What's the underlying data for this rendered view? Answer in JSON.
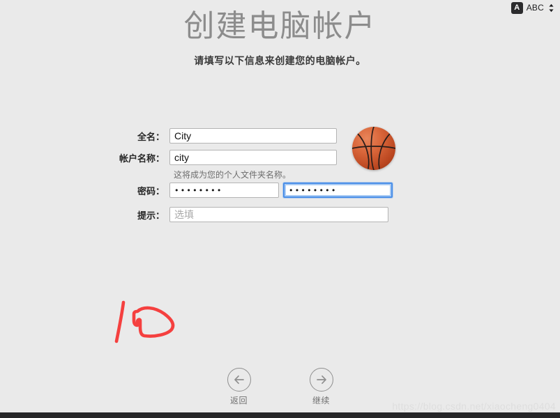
{
  "menubar": {
    "flag_label": "A",
    "input_source": "ABC",
    "chevron_icon": "chevron-up-down-icon"
  },
  "header": {
    "title": "创建电脑帐户",
    "subtitle": "请填写以下信息来创建您的电脑帐户。"
  },
  "form": {
    "fullname": {
      "label": "全名：",
      "value": "City"
    },
    "account": {
      "label": "帐户名称：",
      "value": "city",
      "helper": "这将成为您的个人文件夹名称。"
    },
    "password": {
      "label": "密码：",
      "value": "••••••••",
      "verify_value": "••••••••",
      "focused_field": "verify"
    },
    "hint": {
      "label": "提示：",
      "value": "",
      "placeholder": "选填"
    }
  },
  "avatar": {
    "name": "basketball-avatar",
    "base_color": "#d9663a",
    "seam_color": "#2a1d1a"
  },
  "annotation": {
    "name": "red-handdrawn-mark",
    "color": "#f5403f"
  },
  "nav": {
    "back": {
      "label": "返回",
      "icon": "arrow-left-circle-icon"
    },
    "continue": {
      "label": "继续",
      "icon": "arrow-right-circle-icon"
    }
  },
  "watermark": {
    "text": "https://blog.csdn.net/xiaocheng0404"
  },
  "colors": {
    "background": "#eaeaea",
    "focus_blue": "#4b8fe8",
    "title_gray": "#8c8c8c",
    "bottom_bar": "#262628"
  }
}
